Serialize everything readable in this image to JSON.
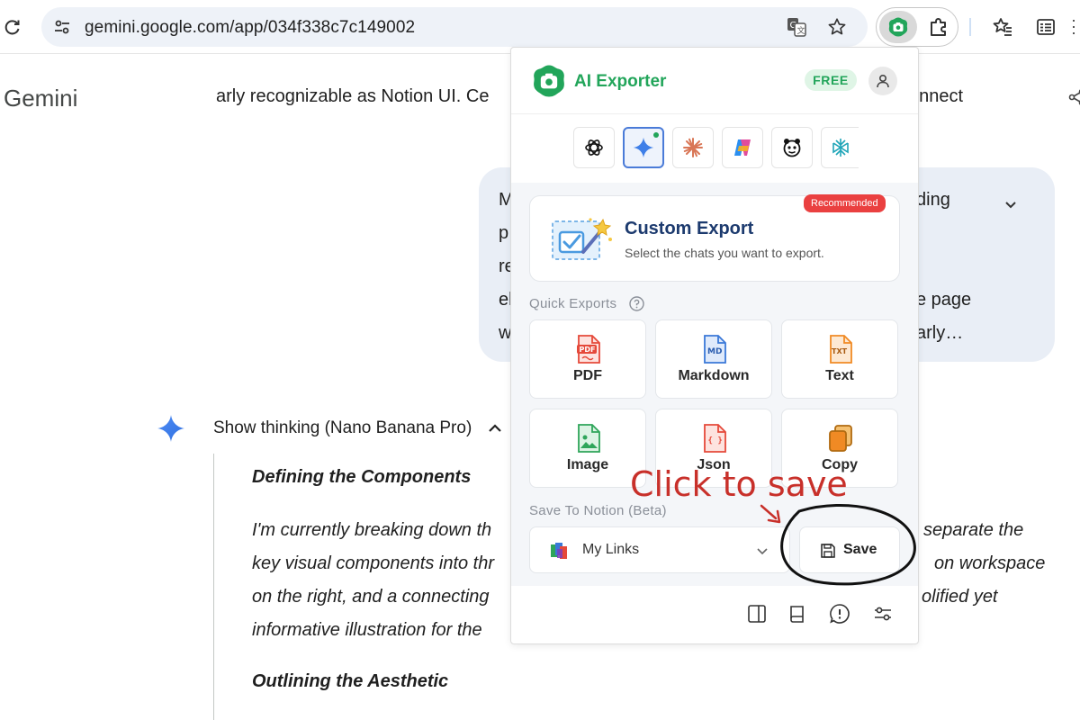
{
  "browser": {
    "url": "gemini.google.com/app/034f338c7c149002",
    "icons": {
      "reload": "reload-icon",
      "site_info": "tune-icon",
      "translate": "translate-icon",
      "bookmark": "star-icon",
      "extension_active": "ai-exporter-icon",
      "extensions": "puzzle-icon",
      "bookmarks_panel": "star-list-icon",
      "reading_list": "reading-list-icon"
    }
  },
  "gemini": {
    "title": "Gemini",
    "truncated_line_left": "arly recognizable as Notion UI. Ce",
    "truncated_line_right": "onnect",
    "user_bubble": {
      "left_chars": [
        "M",
        "p",
        "re",
        "el",
        "w"
      ],
      "right_fragments": [
        "ding",
        "",
        "",
        "e page",
        "arly…"
      ]
    },
    "thinking_label": "Show thinking (Nano Banana Pro)",
    "thought": {
      "heading1": "Defining the Components",
      "lines_left": [
        "I'm currently breaking down th",
        "key visual components into thr",
        "on the right, and a connecting",
        "informative illustration for the"
      ],
      "lines_right": [
        "separate the",
        "on workspace",
        "olified yet"
      ],
      "heading2": "Outlining the Aesthetic"
    }
  },
  "popup": {
    "brand": "AI Exporter",
    "plan_badge": "FREE",
    "sites": [
      {
        "name": "chatgpt-icon",
        "active": false
      },
      {
        "name": "gemini-icon",
        "active": true
      },
      {
        "name": "claude-icon",
        "active": false
      },
      {
        "name": "copilot-icon",
        "active": false
      },
      {
        "name": "deepseek-icon",
        "active": false
      },
      {
        "name": "perplexity-icon",
        "active": false
      }
    ],
    "custom_export": {
      "badge": "Recommended",
      "title": "Custom Export",
      "subtitle": "Select the chats you want to export."
    },
    "quick_exports_label": "Quick Exports",
    "quick_exports": [
      {
        "label": "PDF",
        "icon": "pdf-file-icon",
        "color": "#e5493a",
        "tag": "PDF"
      },
      {
        "label": "Markdown",
        "icon": "markdown-file-icon",
        "color": "#3a78d8",
        "tag": "MD"
      },
      {
        "label": "Text",
        "icon": "text-file-icon",
        "color": "#f08a24",
        "tag": "TXT"
      },
      {
        "label": "Image",
        "icon": "image-file-icon",
        "color": "#2fa55a",
        "tag": ""
      },
      {
        "label": "Json",
        "icon": "json-file-icon",
        "color": "#e5493a",
        "tag": "{ }"
      },
      {
        "label": "Copy",
        "icon": "copy-icon",
        "color": "#f08a24",
        "tag": ""
      }
    ],
    "notion_label": "Save To Notion (Beta)",
    "notion_page": "My Links",
    "save_label": "Save",
    "footer_icons": [
      "sidebar-icon",
      "book-icon",
      "feedback-icon",
      "settings-icon"
    ]
  },
  "annotation": {
    "text": "Click to save",
    "color": "#c8302a"
  },
  "colors": {
    "accent_green": "#22a55a",
    "gemini_blue": "#4a7bd8",
    "recommended_red": "#ea4040"
  }
}
